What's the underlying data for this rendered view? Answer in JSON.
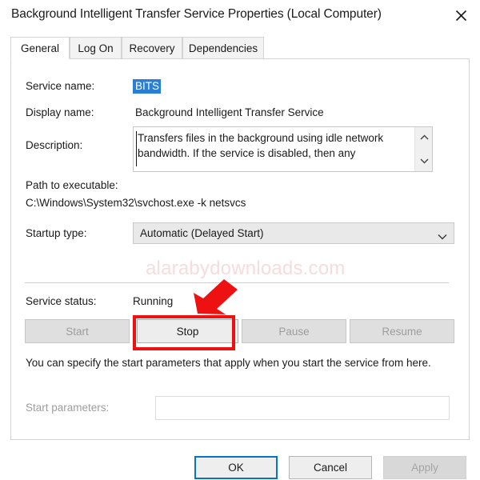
{
  "window": {
    "title": "Background Intelligent Transfer Service Properties (Local Computer)",
    "close_icon": "close-x-icon"
  },
  "tabs": [
    {
      "label": "General",
      "active": true
    },
    {
      "label": "Log On",
      "active": false
    },
    {
      "label": "Recovery",
      "active": false
    },
    {
      "label": "Dependencies",
      "active": false
    }
  ],
  "general": {
    "service_name_label": "Service name:",
    "service_name_value": "BITS",
    "display_name_label": "Display name:",
    "display_name_value": "Background Intelligent Transfer Service",
    "description_label": "Description:",
    "description_value": "Transfers files in the background using idle network bandwidth. If the service is disabled, then any",
    "scroll_up_icon": "chevron-up-icon",
    "scroll_down_icon": "chevron-down-icon",
    "path_label": "Path to executable:",
    "path_value": "C:\\Windows\\System32\\svchost.exe -k netsvcs",
    "startup_type_label": "Startup type:",
    "startup_type_value": "Automatic (Delayed Start)",
    "startup_dropdown_icon": "chevron-down-icon",
    "service_status_label": "Service status:",
    "service_status_value": "Running",
    "buttons": [
      {
        "label": "Start",
        "enabled": false
      },
      {
        "label": "Stop",
        "enabled": true
      },
      {
        "label": "Pause",
        "enabled": false
      },
      {
        "label": "Resume",
        "enabled": false
      }
    ],
    "hint_text": "You can specify the start parameters that apply when you start the service from here.",
    "start_params_label": "Start parameters:",
    "start_params_value": ""
  },
  "footer": {
    "ok_label": "OK",
    "cancel_label": "Cancel",
    "apply_label": "Apply"
  },
  "watermark": {
    "text": "alarabydownloads.com",
    "color": "#f6dcdc"
  },
  "annotation": {
    "color": "#ee1111",
    "arrow_icon": "red-arrow-pointing-down-left",
    "highlight_target": "Stop"
  }
}
